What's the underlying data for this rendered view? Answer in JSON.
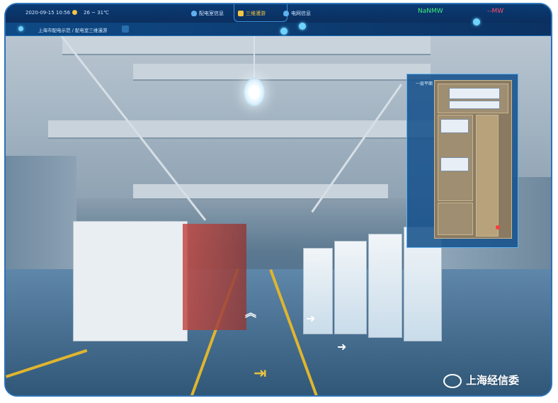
{
  "topbar": {
    "datetime": "2020-09-15 10:56",
    "weather": "26 ~ 31℃",
    "tabs": [
      {
        "label": "配电室信息",
        "icon": "shield-icon",
        "color": "#5fb0ee"
      },
      {
        "label": "三维漫游",
        "icon": "tools-icon",
        "color": "#f5c542"
      },
      {
        "label": "电网信息",
        "icon": "shield-icon",
        "color": "#5fb0ee"
      }
    ],
    "load_label": "NaNMW",
    "load_color": "#3ef07a",
    "capacity_label": "--MW",
    "capacity_color": "#ff4d6a"
  },
  "breadcrumb": {
    "text": "上海市配电示范 / 配电室三维漫游"
  },
  "minimap": {
    "title": "一层平面"
  },
  "watermark": {
    "text": "上海经信委",
    "icon": "wechat-icon"
  }
}
